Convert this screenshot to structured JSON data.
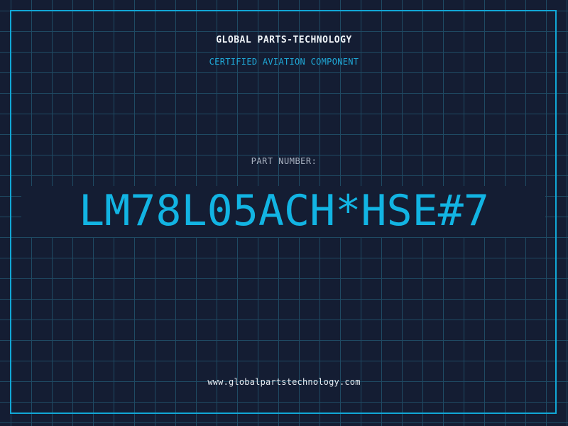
{
  "header": {
    "brand": "GLOBAL PARTS-TECHNOLOGY",
    "subtitle": "CERTIFIED AVIATION COMPONENT"
  },
  "part": {
    "label": "PART NUMBER:",
    "number": "LM78L05ACH*HSE#7"
  },
  "footer": {
    "url": "www.globalpartstechnology.com"
  },
  "colors": {
    "background": "#141d33",
    "grid": "#1f4a63",
    "accent": "#12b4e3",
    "text": "#f0f4f8"
  }
}
